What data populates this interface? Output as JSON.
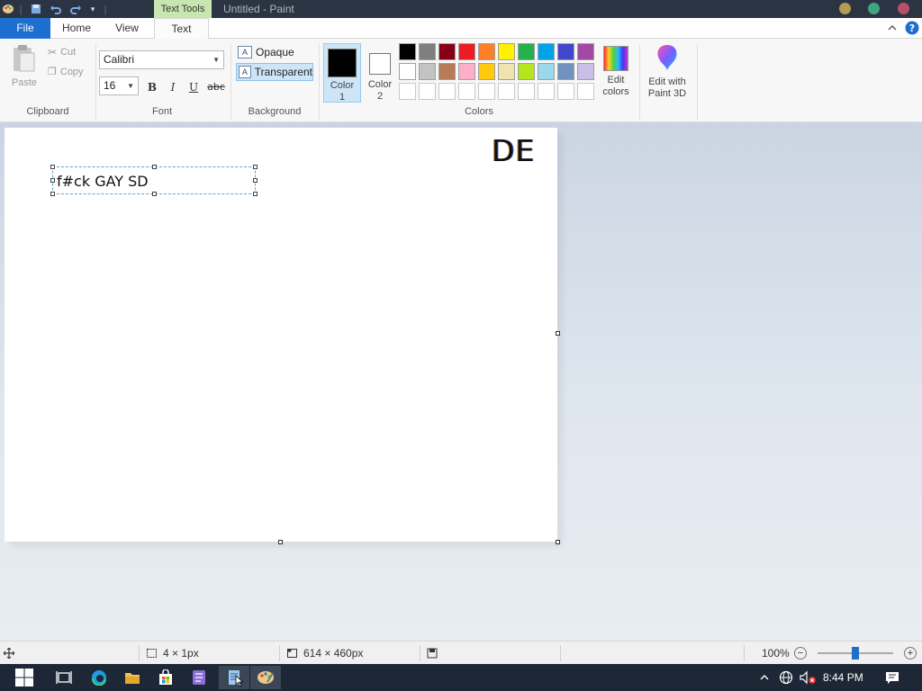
{
  "titlebar": {
    "context_tab": "Text Tools",
    "title": "Untitled - Paint"
  },
  "tabs": [
    {
      "label": "File"
    },
    {
      "label": "Home"
    },
    {
      "label": "View"
    },
    {
      "label": "Text"
    }
  ],
  "clipboard": {
    "paste": "Paste",
    "cut": "Cut",
    "copy": "Copy",
    "group": "Clipboard"
  },
  "font": {
    "family": "Calibri",
    "size": "16",
    "bold": "B",
    "italic": "I",
    "underline": "U",
    "strike": "abc",
    "group": "Font"
  },
  "background": {
    "opaque": "Opaque",
    "transparent": "Transparent",
    "group": "Background"
  },
  "colors": {
    "color1_line1": "Color",
    "color1_line2": "1",
    "color2_line1": "Color",
    "color2_line2": "2",
    "color1_value": "#000000",
    "color2_value": "#ffffff",
    "palette": [
      [
        "#000000",
        "#7f7f7f",
        "#880015",
        "#ed1c24",
        "#ff7f27",
        "#fff200",
        "#22b14c",
        "#00a2e8",
        "#3f48cc",
        "#a349a4"
      ],
      [
        "#ffffff",
        "#c3c3c3",
        "#b97a57",
        "#ffaec9",
        "#ffc90e",
        "#efe4b0",
        "#b5e61d",
        "#99d9ea",
        "#7092be",
        "#c8bfe7"
      ],
      [
        "#ffffff",
        "#ffffff",
        "#ffffff",
        "#ffffff",
        "#ffffff",
        "#ffffff",
        "#ffffff",
        "#ffffff",
        "#ffffff",
        "#ffffff"
      ]
    ],
    "edit_colors_line1": "Edit",
    "edit_colors_line2": "colors",
    "group": "Colors"
  },
  "paint3d": {
    "line1": "Edit with",
    "line2": "Paint 3D"
  },
  "canvas": {
    "textbox_text": "f#ck GAY SD",
    "corner_text": "DE"
  },
  "status": {
    "selection_size": "4 × 1px",
    "canvas_size": "614 × 460px",
    "zoom": "100%",
    "zoom_minus": "−",
    "zoom_plus": "+"
  },
  "taskbar": {
    "time": "8:44 PM"
  }
}
